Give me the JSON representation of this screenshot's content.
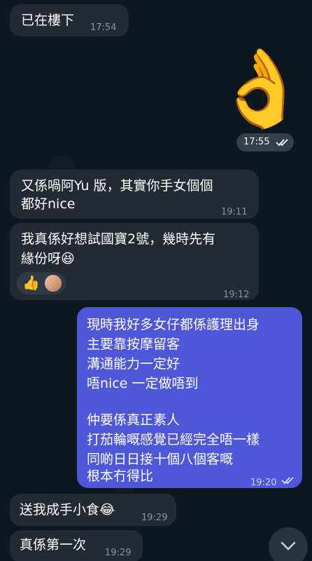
{
  "messages": [
    {
      "id": "m1",
      "side": "in",
      "text": "已在樓下",
      "time": "17:54"
    },
    {
      "id": "m2",
      "side": "out",
      "type": "sticker",
      "emoji": "👌",
      "time": "17:55",
      "read": true
    },
    {
      "id": "m3",
      "side": "in",
      "lines": [
        "又係喎阿Yu 版，其實你手女個個",
        "都好nice"
      ],
      "time": "19:11"
    },
    {
      "id": "m4",
      "side": "in",
      "lines": [
        "我真係好想試國寶2號，幾時先有",
        "緣份呀😆"
      ],
      "time": "19:12",
      "reactions": [
        "👍",
        "avatar"
      ]
    },
    {
      "id": "m5",
      "side": "out",
      "lines": [
        "現時我好多女仔都係護理出身",
        "主要靠按摩留客",
        "溝通能力一定好",
        "唔nice 一定做唔到",
        "",
        "仲要係真正素人",
        "打茄輪嘅感覺已經完全唔一樣",
        "同啲日日接十個八個客嘅",
        "根本冇得比"
      ],
      "time": "19:20",
      "read": true
    },
    {
      "id": "m6",
      "side": "in",
      "text": "送我成手小食😂",
      "time": "19:29"
    },
    {
      "id": "m7",
      "side": "in",
      "text": "真係第一次",
      "time": "19:29"
    }
  ],
  "icons": {
    "read_receipt": "double-check-icon",
    "scroll_down": "chevron-down-icon"
  },
  "colors": {
    "incoming_bubble": "#232a32",
    "outgoing_bubble": "#4e57d8",
    "background": "#0f171f"
  }
}
